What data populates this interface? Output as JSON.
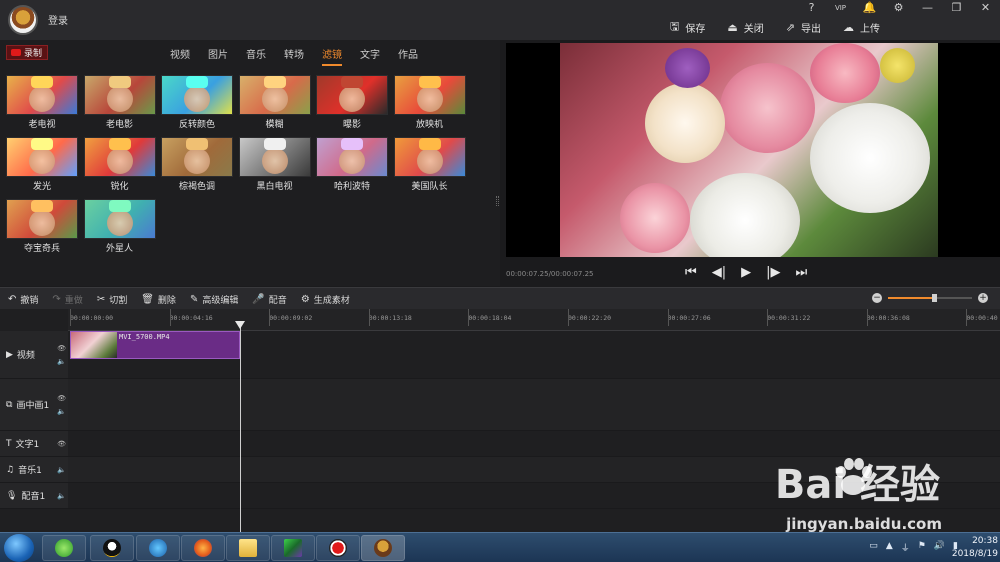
{
  "titlebar": {
    "login": "登录",
    "win_controls": [
      "?",
      "VIP",
      "🔔",
      "⚙",
      "—",
      "❐",
      "✕"
    ],
    "actions": [
      {
        "icon": "save-icon",
        "glyph": "🖫",
        "label": "保存"
      },
      {
        "icon": "close-icon",
        "glyph": "⏏",
        "label": "关闭"
      },
      {
        "icon": "export-icon",
        "glyph": "⇗",
        "label": "导出"
      },
      {
        "icon": "upload-icon",
        "glyph": "☁",
        "label": "上传"
      }
    ]
  },
  "left_panel": {
    "record_label": "录制",
    "tabs": [
      {
        "label": "视频",
        "active": false
      },
      {
        "label": "图片",
        "active": false
      },
      {
        "label": "音乐",
        "active": false
      },
      {
        "label": "转场",
        "active": false
      },
      {
        "label": "滤镜",
        "active": true
      },
      {
        "label": "文字",
        "active": false
      },
      {
        "label": "作品",
        "active": false
      }
    ],
    "effects": [
      "老电视",
      "老电影",
      "反转颜色",
      "模糊",
      "曝影",
      "放映机",
      "发光",
      "锐化",
      "棕褐色调",
      "黑白电视",
      "哈利波特",
      "美国队长",
      "夺宝奇兵",
      "外星人"
    ],
    "accent": "#f08a2c"
  },
  "preview": {
    "time": "00:00:07.25/00:00:07.25",
    "controls": [
      "⏮",
      "◀|",
      "▶",
      "|▶",
      "⏭"
    ]
  },
  "edit_toolbar": {
    "tools": [
      {
        "glyph": "↶",
        "label": "撤销",
        "enabled": true
      },
      {
        "glyph": "↷",
        "label": "重做",
        "enabled": false
      },
      {
        "glyph": "✂",
        "label": "切割",
        "enabled": true
      },
      {
        "glyph": "🗑",
        "label": "删除",
        "enabled": true
      },
      {
        "glyph": "✎",
        "label": "高级编辑",
        "enabled": true
      },
      {
        "glyph": "🎤",
        "label": "配音",
        "enabled": true
      },
      {
        "glyph": "⚙",
        "label": "生成素材",
        "enabled": true
      }
    ],
    "zoom_level": 0.55
  },
  "timeline": {
    "ticks": [
      "00:00:00:00",
      "00:00:04:16",
      "00:00:09:02",
      "00:00:13:18",
      "00:00:18:04",
      "00:00:22:20",
      "00:00:27:06",
      "00:00:31:22",
      "00:00:36:08",
      "00:00:40"
    ],
    "tracks": [
      {
        "glyph": "▶",
        "label": "视频"
      },
      {
        "glyph": "⧉",
        "label": "画中画1"
      },
      {
        "glyph": "T",
        "label": "文字1"
      },
      {
        "glyph": "♫",
        "label": "音乐1"
      },
      {
        "glyph": "🎙",
        "label": "配音1"
      }
    ],
    "clip_name": "MVI_5700.MP4"
  },
  "taskbar": {
    "clock_time": "20:38",
    "clock_date": "2018/8/19"
  },
  "watermark": {
    "text": "Bai 经验",
    "sub": "jingyan.baidu.com"
  }
}
